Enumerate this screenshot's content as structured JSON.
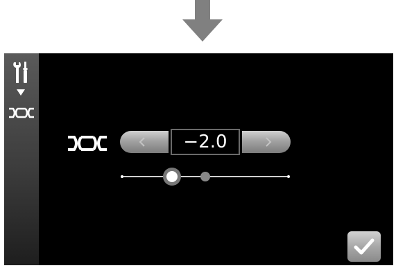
{
  "transition": {
    "arrow_icon": "down-arrow-icon",
    "arrow_color": "#808080"
  },
  "sidebar": {
    "icons": [
      "tools-icon",
      "caret-down-icon",
      "mirror-adjust-icon"
    ]
  },
  "adjustment": {
    "icon": "mirror-adjust-icon",
    "value": "−2.0",
    "prev_icon": "chevron-left-icon",
    "next_icon": "chevron-right-icon"
  },
  "slider": {
    "min": -5,
    "max": 5,
    "default": 0,
    "current": -2
  },
  "confirm": {
    "icon": "checkmark-icon"
  },
  "colors": {
    "screen_background": "#000000",
    "button_gray": "#a2a2a2",
    "text": "#ffffff"
  }
}
